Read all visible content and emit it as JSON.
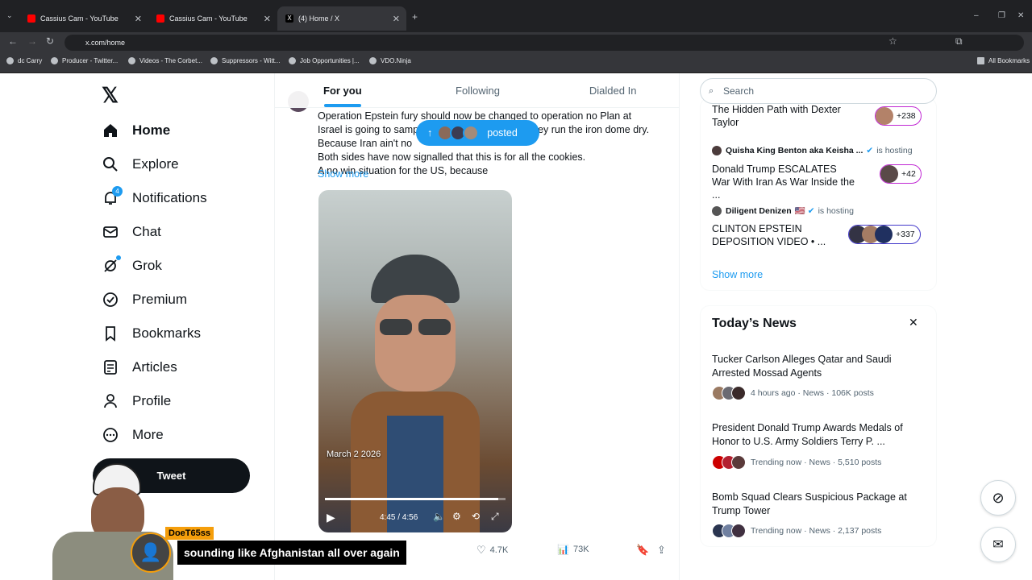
{
  "browser": {
    "tabs": [
      {
        "title": "Cassius Cam - YouTube"
      },
      {
        "title": "Cassius Cam - YouTube"
      },
      {
        "title": "(4) Home / X"
      }
    ],
    "url": "x.com/home",
    "bookmarks": [
      "dc Carry",
      "Producer - Twitter...",
      "Videos - The Corbet...",
      "Suppressors - Witt...",
      "Job Opportunities |...",
      "VDO.Ninja"
    ],
    "all_bookmarks": "All Bookmarks"
  },
  "sidebar": {
    "items": [
      {
        "label": "Home",
        "icon": "home-icon"
      },
      {
        "label": "Explore",
        "icon": "search-icon"
      },
      {
        "label": "Notifications",
        "icon": "bell-icon",
        "badge": "4"
      },
      {
        "label": "Chat",
        "icon": "mail-icon"
      },
      {
        "label": "Grok",
        "icon": "grok-icon"
      },
      {
        "label": "Premium",
        "icon": "premium-icon"
      },
      {
        "label": "Bookmarks",
        "icon": "bookmark-icon"
      },
      {
        "label": "Articles",
        "icon": "articles-icon"
      },
      {
        "label": "Profile",
        "icon": "profile-icon"
      },
      {
        "label": "More",
        "icon": "more-icon"
      }
    ],
    "tweet_button": "Tweet"
  },
  "timeline": {
    "tabs": [
      "For you",
      "Following",
      "Dialded In"
    ],
    "post_lines": [
      "Operation Epstein fury should now be changed to operation no Plan at",
      "Israel is going to sampson option this shit once they run the iron dome dry.",
      "Because Iran ain't no",
      "Both sides have now signalled that this is for all the cookies.",
      "A no win situation for the US, because"
    ],
    "show_more": "Show more",
    "posted_pill": "posted",
    "video": {
      "date_overlay": "March 2 2026",
      "time": "4:45 / 4:56",
      "progress": 0.96
    },
    "metrics": {
      "likes": "4.7K",
      "views": "73K"
    }
  },
  "right": {
    "search_placeholder": "Search",
    "spaces": [
      {
        "title": "The Hidden Path with Dexter Taylor",
        "count": "+238"
      },
      {
        "host": "Quisha King Benton aka Keisha ...",
        "status": "is hosting",
        "title": "Donald Trump ESCALATES War With Iran As War Inside the ...",
        "count": "+42"
      },
      {
        "host": "Diligent Denizen",
        "flag": "🇺🇸",
        "status": "is hosting",
        "title": "CLINTON EPSTEIN DEPOSITION VIDEO  • ...",
        "count": "+337"
      }
    ],
    "show_more": "Show more",
    "news": {
      "heading": "Today’s News",
      "items": [
        {
          "title": "Tucker Carlson Alleges Qatar and Saudi Arrested Mossad Agents",
          "meta": "4 hours ago · News · 106K posts"
        },
        {
          "title": "President Donald Trump Awards Medals of Honor to U.S. Army Soldiers Terry P. ...",
          "meta": "Trending now · News · 5,510 posts"
        },
        {
          "title": "Bomb Squad Clears Suspicious Package at Trump Tower",
          "meta": "Trending now · News · 2,137 posts"
        }
      ]
    }
  },
  "overlay": {
    "username": "DoeT65ss",
    "caption": "sounding like Afghanistan all over again"
  },
  "colors": {
    "accent": "#1d9bf0",
    "text": "#0f1419",
    "muted": "#536471",
    "space_ring": "#c026d3"
  }
}
